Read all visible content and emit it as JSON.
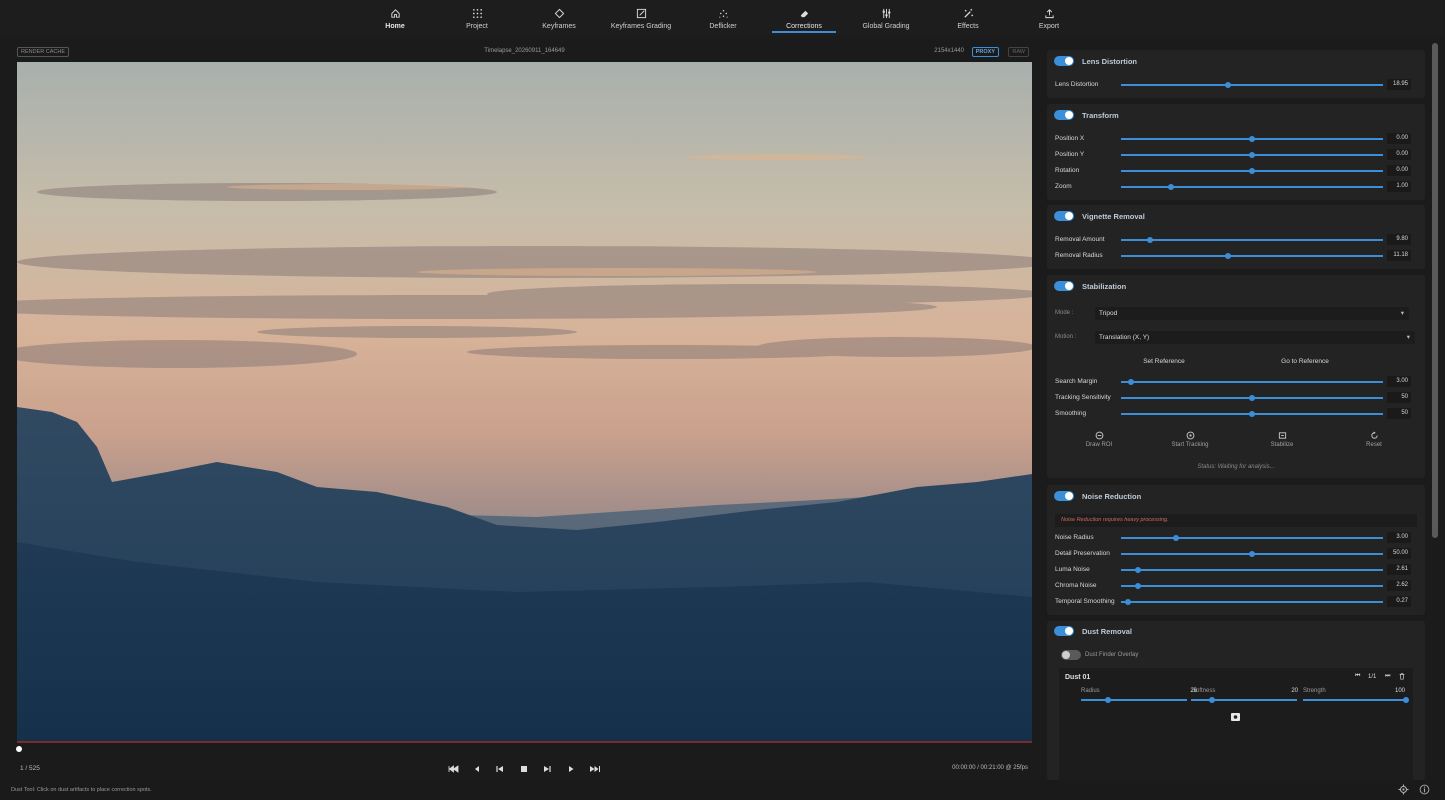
{
  "nav": {
    "items": [
      {
        "label": "Home",
        "icon": "home-icon"
      },
      {
        "label": "Project",
        "icon": "grid-icon"
      },
      {
        "label": "Keyframes",
        "icon": "diamond-icon"
      },
      {
        "label": "Keyframes Grading",
        "icon": "edit-icon"
      },
      {
        "label": "Deflicker",
        "icon": "sparkle-icon"
      },
      {
        "label": "Corrections",
        "icon": "eraser-icon"
      },
      {
        "label": "Global Grading",
        "icon": "sliders-icon"
      },
      {
        "label": "Effects",
        "icon": "magic-wand-icon"
      },
      {
        "label": "Export",
        "icon": "upload-icon"
      }
    ],
    "active": "Corrections"
  },
  "viewer": {
    "render_cache": "RENDER CACHE",
    "filename": "Timelapse_20260911_164649",
    "resolution": "2154x1440",
    "proxy": "PROXY",
    "raw": "RAW"
  },
  "transport": {
    "frame_counter": "1 / 525",
    "timecode": "00:00:00 / 00:21:00 @ 25fps",
    "progress": 0.002
  },
  "status": {
    "message": "Dust Tool: Click on dust artifacts to place correction spots."
  },
  "panels": {
    "lens": {
      "title": "Lens Distortion",
      "enabled": true,
      "sliders": [
        {
          "label": "Lens Distortion",
          "value": "18.95",
          "pos": 0.41
        }
      ]
    },
    "transform": {
      "title": "Transform",
      "enabled": true,
      "sliders": [
        {
          "label": "Position X",
          "value": "0.00",
          "pos": 0.5
        },
        {
          "label": "Position Y",
          "value": "0.00",
          "pos": 0.5
        },
        {
          "label": "Rotation",
          "value": "0.00",
          "pos": 0.5
        },
        {
          "label": "Zoom",
          "value": "1.00",
          "pos": 0.19
        }
      ]
    },
    "vignette": {
      "title": "Vignette Removal",
      "enabled": true,
      "sliders": [
        {
          "label": "Removal Amount",
          "value": "9.80",
          "pos": 0.11
        },
        {
          "label": "Removal Radius",
          "value": "11.18",
          "pos": 0.41
        }
      ]
    },
    "stabilization": {
      "title": "Stabilization",
      "enabled": true,
      "mode_label": "Mode :",
      "mode_value": "Tripod",
      "motion_label": "Motion :",
      "motion_value": "Translation (X, Y)",
      "set_reference": "Set Reference",
      "goto_reference": "Go to Reference",
      "sliders": [
        {
          "label": "Search Margin",
          "value": "3.00",
          "pos": 0.04
        },
        {
          "label": "Tracking Sensitivity",
          "value": "50",
          "pos": 0.5
        },
        {
          "label": "Smoothing",
          "value": "50",
          "pos": 0.5
        }
      ],
      "tools": [
        {
          "label": "Draw ROI",
          "icon": "roi-icon"
        },
        {
          "label": "Start Tracking",
          "icon": "tracking-icon"
        },
        {
          "label": "Stabilize",
          "icon": "stabilize-icon"
        },
        {
          "label": "Reset",
          "icon": "reset-icon"
        }
      ],
      "status": "Status: Waiting for analysis..."
    },
    "noise": {
      "title": "Noise Reduction",
      "enabled": true,
      "warning": "Noise Reduction requires heavy processing.",
      "sliders": [
        {
          "label": "Noise Radius",
          "value": "3.00",
          "pos": 0.21
        },
        {
          "label": "Detail Preservation",
          "value": "50.00",
          "pos": 0.5
        },
        {
          "label": "Luma Noise",
          "value": "2.61",
          "pos": 0.065
        },
        {
          "label": "Chroma Noise",
          "value": "2.62",
          "pos": 0.065
        },
        {
          "label": "Temporal Smoothing",
          "value": "0.27",
          "pos": 0.025
        }
      ]
    },
    "dust": {
      "title": "Dust Removal",
      "enabled": true,
      "overlay_label": "Dust Finder Overlay",
      "overlay_enabled": false,
      "spot_title": "Dust 01",
      "spot_counter": "1/1",
      "params": [
        {
          "label": "Radius",
          "value": "26",
          "pos": 0.25
        },
        {
          "label": "Softness",
          "value": "20",
          "pos": 0.2
        },
        {
          "label": "Strength",
          "value": "100",
          "pos": 1.0
        }
      ]
    }
  },
  "colors": {
    "accent": "#3a8fd8",
    "panel": "#232323",
    "background": "#1b1b1b"
  }
}
